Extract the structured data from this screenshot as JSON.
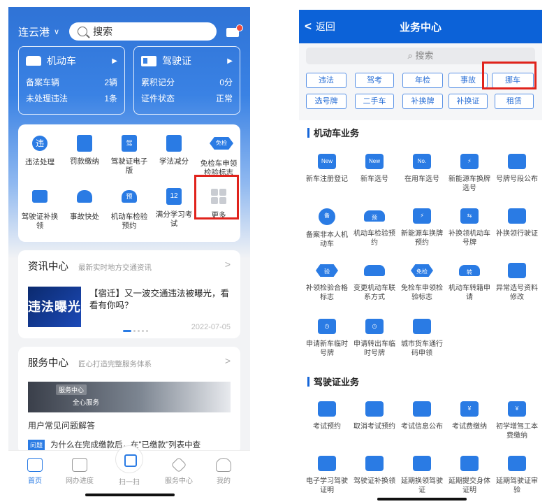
{
  "left": {
    "city": "连云港",
    "search_text": "搜索",
    "cards": [
      {
        "title": "机动车",
        "rows": [
          {
            "label": "备案车辆",
            "value": "2辆"
          },
          {
            "label": "未处理违法",
            "value": "1条"
          }
        ]
      },
      {
        "title": "驾驶证",
        "rows": [
          {
            "label": "累积记分",
            "value": "0分"
          },
          {
            "label": "证件状态",
            "value": "正常"
          }
        ]
      }
    ],
    "grid": [
      {
        "label": "违法处理",
        "glyph": "违"
      },
      {
        "label": "罚款缴纳",
        "glyph": ""
      },
      {
        "label": "驾驶证电子版",
        "glyph": "驾"
      },
      {
        "label": "学法减分",
        "glyph": ""
      },
      {
        "label": "免检车申领检验标志",
        "glyph": "免检"
      },
      {
        "label": "驾驶证补换领",
        "glyph": ""
      },
      {
        "label": "事故快处",
        "glyph": ""
      },
      {
        "label": "机动车检验预约",
        "glyph": "预"
      },
      {
        "label": "满分学习考试",
        "glyph": "12"
      },
      {
        "label": "更多",
        "glyph": ""
      }
    ],
    "news": {
      "title": "资讯中心",
      "subtitle": "最新实时地方交通资讯",
      "image_text": "违法曝光",
      "headline": "【宿迁】又一波交通违法被曝光，看看有你吗？",
      "date": "2022-07-05"
    },
    "service": {
      "title": "服务中心",
      "subtitle": "匠心打造完整服务体系",
      "banner_tag": "服务中心",
      "banner_caption": "全心服务",
      "faq_title": "用户常见问题解答",
      "faq_badge": "问题",
      "faq_row": "为什么在完成缴款后，在\"已缴款\"列表中查"
    },
    "tabs": [
      "首页",
      "网办进度",
      "扫一扫",
      "服务中心",
      "我的"
    ]
  },
  "right": {
    "back_label": "返回",
    "title": "业务中心",
    "search_placeholder": "搜索",
    "chips": [
      "违法",
      "驾考",
      "年检",
      "事故",
      "挪车",
      "选号牌",
      "二手车",
      "补换牌",
      "补换证",
      "租赁"
    ],
    "vehicle_section": "机动车业务",
    "vehicle_items": [
      {
        "label": "新车注册登记",
        "glyph": "New"
      },
      {
        "label": "新车选号",
        "glyph": "New"
      },
      {
        "label": "在用车选号",
        "glyph": "No."
      },
      {
        "label": "新能源车换牌选号",
        "glyph": "⚡"
      },
      {
        "label": "号牌号段公布",
        "glyph": ""
      },
      {
        "label": "备案非本人机动车",
        "glyph": "备"
      },
      {
        "label": "机动车检验预约",
        "glyph": "预"
      },
      {
        "label": "新能源车换牌预约",
        "glyph": "⚡"
      },
      {
        "label": "补换领机动车号牌",
        "glyph": "⇆"
      },
      {
        "label": "补换领行驶证",
        "glyph": ""
      },
      {
        "label": "补领检验合格标志",
        "glyph": "验"
      },
      {
        "label": "变更机动车联系方式",
        "glyph": ""
      },
      {
        "label": "免检车申领检验标志",
        "glyph": "免检"
      },
      {
        "label": "机动车转籍申请",
        "glyph": "转"
      },
      {
        "label": "异常选号资料修改",
        "glyph": ""
      },
      {
        "label": "申请新车临时号牌",
        "glyph": "◷"
      },
      {
        "label": "申请转出车临时号牌",
        "glyph": "◷"
      },
      {
        "label": "城市货车通行码申领",
        "glyph": ""
      }
    ],
    "license_section": "驾驶证业务",
    "license_items": [
      {
        "label": "考试预约",
        "glyph": ""
      },
      {
        "label": "取消考试预约",
        "glyph": ""
      },
      {
        "label": "考试信息公布",
        "glyph": ""
      },
      {
        "label": "考试费缴纳",
        "glyph": "¥"
      },
      {
        "label": "初学增驾工本费缴纳",
        "glyph": "¥"
      },
      {
        "label": "电子学习驾驶证明",
        "glyph": ""
      },
      {
        "label": "驾驶证补换领",
        "glyph": ""
      },
      {
        "label": "延期换领驾驶证",
        "glyph": ""
      },
      {
        "label": "延期提交身体证明",
        "glyph": ""
      },
      {
        "label": "延期驾驶证审验",
        "glyph": ""
      }
    ]
  },
  "colors": {
    "brand": "#0c62d8",
    "accent": "#2a7be4",
    "highlight": "#e0231c"
  }
}
